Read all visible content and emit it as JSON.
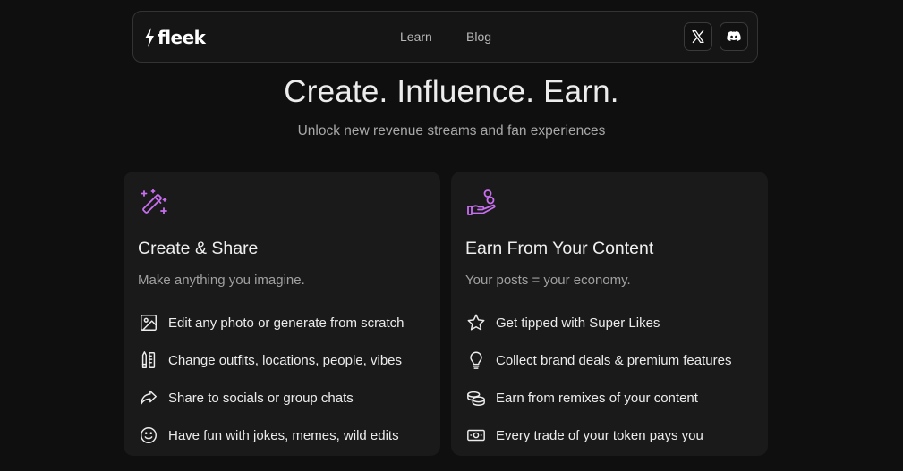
{
  "navbar": {
    "logo_text": "fleek",
    "links": [
      {
        "label": "Learn"
      },
      {
        "label": "Blog"
      }
    ],
    "social": [
      {
        "icon": "x-icon"
      },
      {
        "icon": "discord-icon"
      }
    ]
  },
  "hero": {
    "title": "Create. Influence. Earn.",
    "subtitle": "Unlock new revenue streams and fan experiences"
  },
  "colors": {
    "accent": "#c86ef0",
    "background": "#0f0f0f",
    "card": "#1a1a1a"
  },
  "cards": [
    {
      "icon": "magic-wand-icon",
      "title": "Create & Share",
      "subtitle": "Make anything you imagine.",
      "features": [
        {
          "icon": "image-icon",
          "text": "Edit any photo or generate from scratch"
        },
        {
          "icon": "pencil-ruler-icon",
          "text": "Change outfits, locations, people, vibes"
        },
        {
          "icon": "share-arrow-icon",
          "text": "Share to socials or group chats"
        },
        {
          "icon": "smiley-icon",
          "text": "Have fun with jokes, memes, wild edits"
        }
      ]
    },
    {
      "icon": "hand-coins-icon",
      "title": "Earn From Your Content",
      "subtitle": "Your posts = your economy.",
      "features": [
        {
          "icon": "star-icon",
          "text": "Get tipped with Super Likes"
        },
        {
          "icon": "lightbulb-icon",
          "text": "Collect brand deals & premium features"
        },
        {
          "icon": "coins-icon",
          "text": "Earn from remixes of your content"
        },
        {
          "icon": "banknote-icon",
          "text": "Every trade of your token pays you"
        }
      ]
    }
  ]
}
